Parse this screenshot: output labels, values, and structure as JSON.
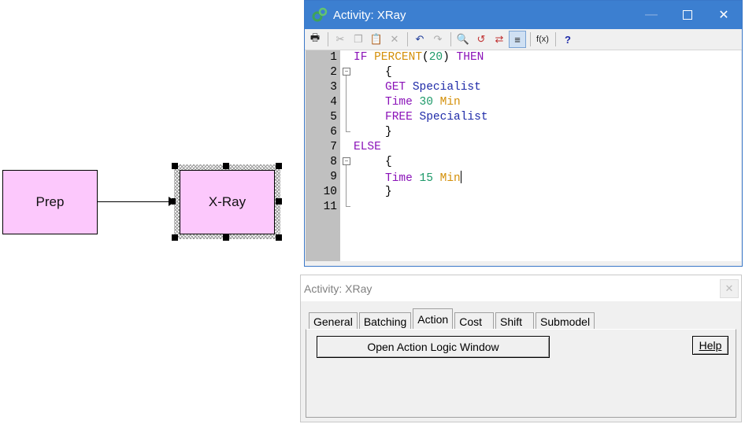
{
  "canvas": {
    "blocks": [
      {
        "id": "prep",
        "label": "Prep"
      },
      {
        "id": "xray",
        "label": "X-Ray"
      }
    ],
    "block_color": "#fcc8fc"
  },
  "logic_window": {
    "title": "Activity: XRay",
    "title_bar_color": "#3c7fd0",
    "toolbar_icons": [
      "print-icon",
      "cut-icon",
      "copy-icon",
      "paste-icon",
      "delete-icon",
      "undo-icon",
      "redo-icon",
      "find-icon",
      "replace-icon",
      "toggle-icon",
      "format-icon",
      "function-icon",
      "help-icon"
    ],
    "lines": [
      {
        "n": "1"
      },
      {
        "n": "2"
      },
      {
        "n": "3"
      },
      {
        "n": "4"
      },
      {
        "n": "5"
      },
      {
        "n": "6"
      },
      {
        "n": "7"
      },
      {
        "n": "8"
      },
      {
        "n": "9"
      },
      {
        "n": "10"
      },
      {
        "n": "11"
      }
    ],
    "code": {
      "l1_if": "IF",
      "l1_fn": "PERCENT",
      "l1_open": "(",
      "l1_num": "20",
      "l1_close": ")",
      "l1_then": "THEN",
      "l2": "{",
      "l3_kw": "GET",
      "l3_res": "Specialist",
      "l4_kw": "Time",
      "l4_num": "30",
      "l4_unit": "Min",
      "l5_kw": "FREE",
      "l5_res": "Specialist",
      "l6": "}",
      "l7": "ELSE",
      "l8": "{",
      "l9_kw": "Time",
      "l9_num": "15",
      "l9_unit": "Min",
      "l10": "}"
    }
  },
  "dialog": {
    "title": "Activity: XRay",
    "close": "✕",
    "tabs": [
      "General",
      "Batching",
      "Action",
      "Cost",
      "Shift",
      "Submodel"
    ],
    "active_tab": "Action",
    "open_logic_button": "Open Action Logic Window",
    "help_button": "Help"
  }
}
